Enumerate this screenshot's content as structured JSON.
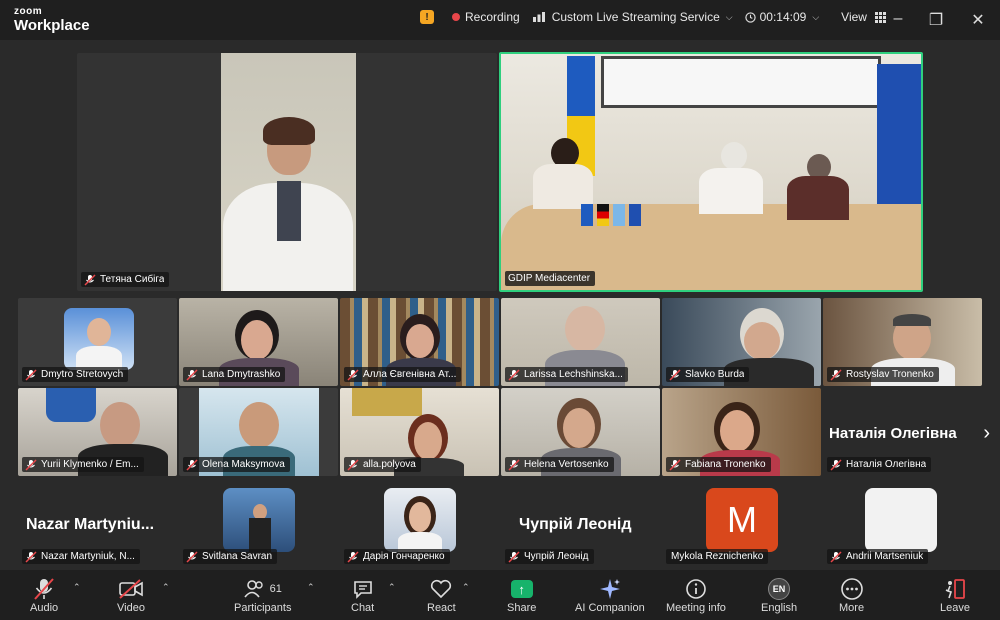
{
  "app": {
    "logo_top": "zoom",
    "logo_bottom": "Workplace",
    "recording_label": "Recording",
    "streaming_label": "Custom Live Streaming Service",
    "timer": "00:14:09",
    "view_label": "View"
  },
  "main_tiles": [
    {
      "name": "Тетяна Сибіга"
    },
    {
      "name": "GDIP Mediacenter"
    }
  ],
  "gallery": [
    {
      "name": "Dmytro Stretovych"
    },
    {
      "name": "Lana Dmytrashko"
    },
    {
      "name": "Алла Євгенівна Ат..."
    },
    {
      "name": "Larissa Lechshinska..."
    },
    {
      "name": "Slavko Burda"
    },
    {
      "name": "Rostyslav Tronenko"
    },
    {
      "name": "Yurii Klymenko / Em..."
    },
    {
      "name": "Olena Maksymova"
    },
    {
      "name": "alla.polyova"
    },
    {
      "name": "Helena Vertosenko"
    },
    {
      "name": "Fabiana Tronenko"
    },
    {
      "name": "Наталія Олегівна",
      "big": "Наталія Олегівна"
    },
    {
      "name": "Nazar Martyniuk, N...",
      "big": "Nazar  Martyniu..."
    },
    {
      "name": "Svitlana Savran"
    },
    {
      "name": "Дарія Гончаренко"
    },
    {
      "name": "Чупрій Леонід",
      "big": "Чупрій Леонід"
    },
    {
      "name": "Mykola Reznichenko",
      "avatar": "M"
    },
    {
      "name": "Andrii Martseniuk"
    }
  ],
  "toolbar": {
    "audio": "Audio",
    "video": "Video",
    "participants": "Participants",
    "participants_count": "61",
    "chat": "Chat",
    "react": "React",
    "share": "Share",
    "ai": "AI Companion",
    "meeting_info": "Meeting info",
    "english": "English",
    "en_badge": "EN",
    "more": "More",
    "leave": "Leave"
  },
  "colors": {
    "recording": "#e8464a",
    "active_speaker": "#2fcf7e",
    "share": "#17b36b",
    "leave": "#e8464a",
    "avatar_m": "#d9481c"
  }
}
